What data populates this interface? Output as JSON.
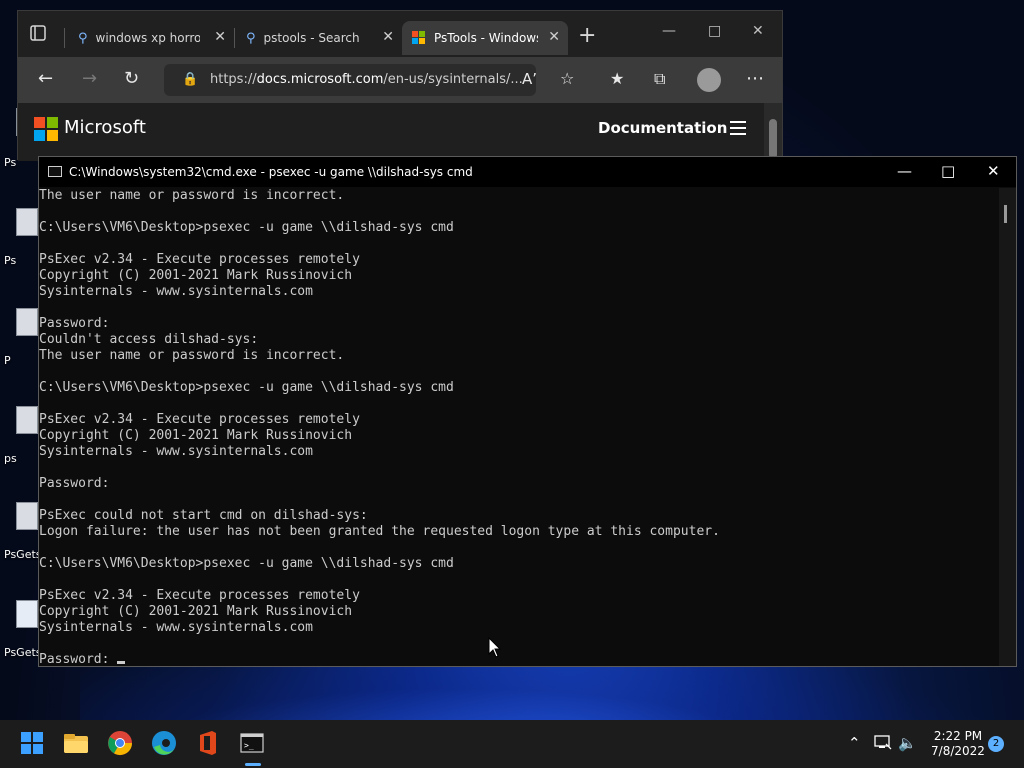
{
  "desktop": {
    "icons": [
      {
        "label": "Ps"
      },
      {
        "label": "Ps"
      },
      {
        "label": "P"
      },
      {
        "label": "ps"
      },
      {
        "label": "PsGets"
      },
      {
        "label": "PsGets"
      }
    ]
  },
  "browser": {
    "tabs": [
      {
        "title": "windows xp horror",
        "icon": "search-icon"
      },
      {
        "title": "pstools - Search",
        "icon": "search-icon"
      },
      {
        "title": "PsTools - Windows",
        "icon": "microsoft-icon"
      }
    ],
    "url_prefix": "https://",
    "url_host": "docs.microsoft.com",
    "url_path": "/en-us/sysinternals/...",
    "page": {
      "brand": "Microsoft",
      "nav_link": "Documentation"
    }
  },
  "cmd": {
    "title": "C:\\Windows\\system32\\cmd.exe - psexec  -u game \\\\dilshad-sys cmd",
    "lines": [
      "The user name or password is incorrect.",
      "",
      "C:\\Users\\VM6\\Desktop>psexec -u game \\\\dilshad-sys cmd",
      "",
      "PsExec v2.34 - Execute processes remotely",
      "Copyright (C) 2001-2021 Mark Russinovich",
      "Sysinternals - www.sysinternals.com",
      "",
      "Password:",
      "Couldn't access dilshad-sys:",
      "The user name or password is incorrect.",
      "",
      "C:\\Users\\VM6\\Desktop>psexec -u game \\\\dilshad-sys cmd",
      "",
      "PsExec v2.34 - Execute processes remotely",
      "Copyright (C) 2001-2021 Mark Russinovich",
      "Sysinternals - www.sysinternals.com",
      "",
      "Password:",
      "",
      "PsExec could not start cmd on dilshad-sys:",
      "Logon failure: the user has not been granted the requested logon type at this computer.",
      "",
      "C:\\Users\\VM6\\Desktop>psexec -u game \\\\dilshad-sys cmd",
      "",
      "PsExec v2.34 - Execute processes remotely",
      "Copyright (C) 2001-2021 Mark Russinovich",
      "Sysinternals - www.sysinternals.com",
      "",
      "Password: "
    ]
  },
  "taskbar": {
    "apps": [
      "windows-start-icon",
      "file-explorer-icon",
      "chrome-icon",
      "edge-icon",
      "office-icon",
      "cmd-icon"
    ],
    "time": "2:22 PM",
    "date": "7/8/2022",
    "notification_count": "2"
  },
  "colors": {
    "console_text": "#cccccc",
    "console_bg": "#0c0c0c",
    "accent": "#5cb0ff"
  }
}
